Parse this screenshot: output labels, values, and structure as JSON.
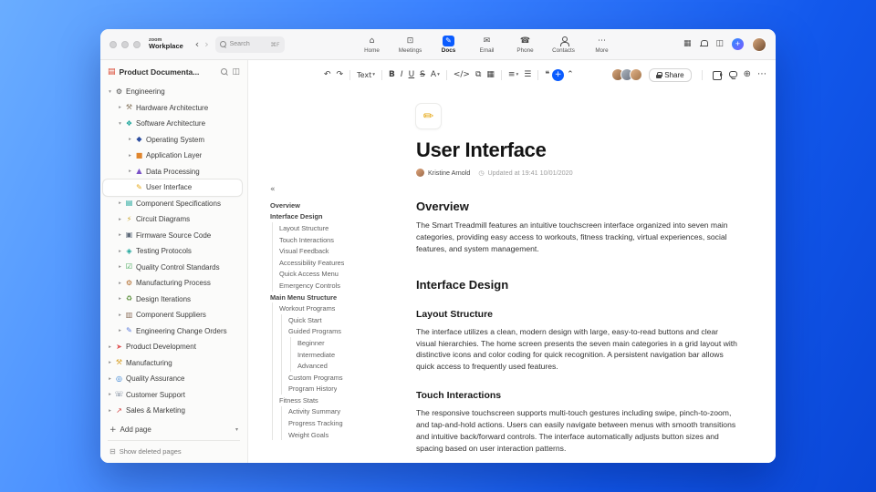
{
  "accent": "#0b5cff",
  "icons": {
    "chevron_down": "▾",
    "chevron_right": "▸",
    "caret": "▾",
    "collapse_outline": "«",
    "plus": "+",
    "grid": "▦",
    "panel": "◫",
    "globe": "⊕",
    "more": "⋯",
    "workspace": "▤",
    "trash": "⊟",
    "clock": "◷"
  },
  "titlebar": {
    "logo_top": "zoom",
    "logo_bottom": "Workplace",
    "back": "‹",
    "forward": "›",
    "search": {
      "placeholder": "Search",
      "shortcut": "⌘F"
    },
    "tabs": [
      {
        "label": "Home",
        "glyph": "⌂"
      },
      {
        "label": "Meetings",
        "glyph": "⊡"
      },
      {
        "label": "Docs",
        "glyph": "✎",
        "chip": true,
        "active": true
      },
      {
        "label": "Email",
        "glyph": "✉"
      },
      {
        "label": "Phone",
        "glyph": "☎"
      },
      {
        "label": "Contacts",
        "cls": "person-ic"
      },
      {
        "label": "More",
        "glyph": "⋯"
      }
    ]
  },
  "sidebar": {
    "workspace_title": "Product Documenta...",
    "add_page_label": "Add page",
    "show_deleted_label": "Show deleted pages",
    "tree": [
      {
        "level": 0,
        "label": "Engineering",
        "chevron": "down",
        "glyph": "⚙",
        "color": "#4f4f4f"
      },
      {
        "level": 1,
        "label": "Hardware Architecture",
        "chevron": "right",
        "glyph": "⚒",
        "color": "#8a7a64"
      },
      {
        "level": 1,
        "label": "Software Architecture",
        "chevron": "down",
        "glyph": "❖",
        "color": "#17a398"
      },
      {
        "level": 2,
        "label": "Operating System",
        "chevron": "right",
        "glyph": "◆",
        "color": "#2d4ea0"
      },
      {
        "level": 2,
        "label": "Application Layer",
        "chevron": "right",
        "glyph": "■",
        "color": "#e0862e"
      },
      {
        "level": 2,
        "label": "Data Processing",
        "chevron": "right",
        "glyph": "▲",
        "color": "#7a52c7"
      },
      {
        "level": 2,
        "label": "User Interface",
        "chevron": "none",
        "glyph": "✎",
        "color": "#e6a817",
        "selected": true
      },
      {
        "level": 1,
        "label": "Component Specifications",
        "chevron": "right",
        "glyph": "▤",
        "color": "#17a398"
      },
      {
        "level": 1,
        "label": "Circuit Diagrams",
        "chevron": "right",
        "glyph": "⚡",
        "color": "#c9a227"
      },
      {
        "level": 1,
        "label": "Firmware Source Code",
        "chevron": "right",
        "glyph": "▣",
        "color": "#5f6b7a"
      },
      {
        "level": 1,
        "label": "Testing Protocols",
        "chevron": "right",
        "glyph": "◈",
        "color": "#17a398"
      },
      {
        "level": 1,
        "label": "Quality Control Standards",
        "chevron": "right",
        "glyph": "☑",
        "color": "#2e9e44"
      },
      {
        "level": 1,
        "label": "Manufacturing Process",
        "chevron": "right",
        "glyph": "⚙",
        "color": "#b06a2a"
      },
      {
        "level": 1,
        "label": "Design Iterations",
        "chevron": "right",
        "glyph": "♻",
        "color": "#5a8f3a"
      },
      {
        "level": 1,
        "label": "Component Suppliers",
        "chevron": "right",
        "glyph": "▥",
        "color": "#8a6e5a"
      },
      {
        "level": 1,
        "label": "Engineering Change Orders",
        "chevron": "right",
        "glyph": "✎",
        "color": "#5a7adb"
      },
      {
        "level": 0,
        "label": "Product Development",
        "chevron": "right",
        "glyph": "➤",
        "color": "#e05252"
      },
      {
        "level": 0,
        "label": "Manufacturing",
        "chevron": "right",
        "glyph": "⚒",
        "color": "#d9a32e"
      },
      {
        "level": 0,
        "label": "Quality Assurance",
        "chevron": "right",
        "glyph": "◎",
        "color": "#2d7dd2"
      },
      {
        "level": 0,
        "label": "Customer Support",
        "chevron": "right",
        "glyph": "☏",
        "color": "#607086"
      },
      {
        "level": 0,
        "label": "Sales & Marketing",
        "chevron": "right",
        "glyph": "↗",
        "color": "#d23f3f"
      }
    ]
  },
  "toolbar": {
    "buttons": [
      {
        "name": "undo",
        "glyph": "↶"
      },
      {
        "name": "redo",
        "glyph": "↷"
      },
      {
        "type": "divider"
      },
      {
        "name": "text-style",
        "glyph": "Text",
        "caret": true,
        "cls": "tb-text-style"
      },
      {
        "type": "divider"
      },
      {
        "name": "bold",
        "glyph": "B",
        "cls": "tb-bold"
      },
      {
        "name": "italic",
        "glyph": "I",
        "cls": "tb-italic"
      },
      {
        "name": "underline",
        "glyph": "U",
        "cls": "tb-underline"
      },
      {
        "name": "strikethrough",
        "glyph": "S",
        "cls": "tb-strikethrough"
      },
      {
        "name": "text-color",
        "glyph": "A",
        "caret": true
      },
      {
        "type": "divider"
      },
      {
        "name": "code",
        "glyph": "</>"
      },
      {
        "name": "link",
        "glyph": "⧉"
      },
      {
        "name": "table",
        "glyph": "▦"
      },
      {
        "type": "divider"
      },
      {
        "name": "align",
        "glyph": "≡",
        "caret": true
      },
      {
        "name": "list",
        "glyph": "☰"
      },
      {
        "type": "divider"
      },
      {
        "name": "comment",
        "glyph": "❝"
      },
      {
        "name": "insert",
        "glyph": "+",
        "cls": "tb-insert"
      },
      {
        "name": "collapse-toolbar",
        "glyph": "⌃"
      }
    ],
    "avatars": [
      [
        "#d8a87e",
        "#8a5f3c"
      ],
      [
        "#aeb6bf",
        "#6b7280"
      ],
      [
        "#e2b48a",
        "#a3744a"
      ]
    ],
    "share_label": "Share"
  },
  "outline": {
    "items": [
      {
        "level": 0,
        "label": "Overview"
      },
      {
        "level": 0,
        "label": "Interface Design"
      },
      {
        "level": 1,
        "label": "Layout Structure"
      },
      {
        "level": 1,
        "label": "Touch Interactions"
      },
      {
        "level": 1,
        "label": "Visual Feedback"
      },
      {
        "level": 1,
        "label": "Accessibility Features"
      },
      {
        "level": 1,
        "label": "Quick Access Menu"
      },
      {
        "level": 1,
        "label": "Emergency Controls"
      },
      {
        "level": 0,
        "label": "Main Menu Structure"
      },
      {
        "level": 1,
        "label": "Workout Programs"
      },
      {
        "level": 2,
        "label": "Quick Start"
      },
      {
        "level": 2,
        "label": "Guided Programs"
      },
      {
        "level": 3,
        "label": "Beginner"
      },
      {
        "level": 3,
        "label": "Intermediate"
      },
      {
        "level": 3,
        "label": "Advanced"
      },
      {
        "level": 2,
        "label": "Custom Programs"
      },
      {
        "level": 2,
        "label": "Program History"
      },
      {
        "level": 1,
        "label": "Fitness Stats"
      },
      {
        "level": 2,
        "label": "Activity Summary"
      },
      {
        "level": 2,
        "label": "Progress Tracking"
      },
      {
        "level": 2,
        "label": "Weight Goals"
      }
    ]
  },
  "doc": {
    "emoji": "✏",
    "title": "User Interface",
    "author": "Kristine Arnold",
    "updated": "Updated at 19:41 10/01/2020",
    "sections": [
      {
        "type": "h2",
        "text": "Overview"
      },
      {
        "type": "p",
        "text": "The Smart Treadmill features an intuitive touchscreen interface organized into seven main categories, providing easy access to workouts, fitness tracking, virtual experiences, social features, and system management."
      },
      {
        "type": "h2",
        "text": "Interface Design"
      },
      {
        "type": "h3",
        "text": "Layout Structure"
      },
      {
        "type": "p",
        "text": "The interface utilizes a clean, modern design with large, easy-to-read buttons and clear visual hierarchies. The home screen presents the seven main categories in a grid layout with distinctive icons and color coding for quick recognition. A persistent navigation bar allows quick access to frequently used features."
      },
      {
        "type": "h3",
        "text": "Touch Interactions"
      },
      {
        "type": "p",
        "text": "The responsive touchscreen supports multi-touch gestures including swipe, pinch-to-zoom, and tap-and-hold actions. Users can easily navigate between menus with smooth transitions and intuitive back/forward controls. The interface automatically adjusts button sizes and spacing based on user interaction patterns."
      }
    ]
  }
}
